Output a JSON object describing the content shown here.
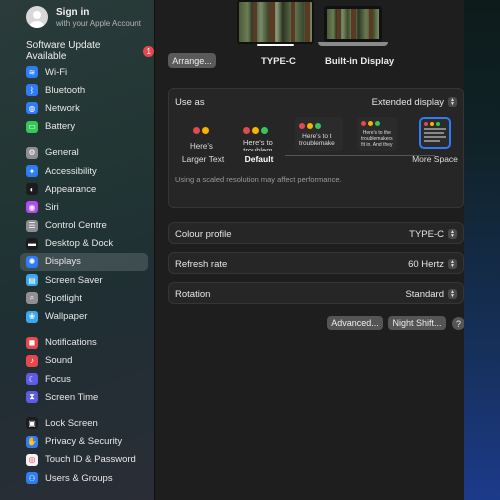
{
  "sidebar": {
    "signin": {
      "title": "Sign in",
      "subtitle": "with your Apple Account"
    },
    "update": {
      "label": "Software Update Available",
      "badge": "1"
    },
    "groups": [
      [
        {
          "label": "Wi-Fi",
          "icon": "wifi-icon",
          "color": "#2f7cf6",
          "glyph": "≋"
        },
        {
          "label": "Bluetooth",
          "icon": "bluetooth-icon",
          "color": "#2f7cf6",
          "glyph": "ᛒ"
        },
        {
          "label": "Network",
          "icon": "globe-icon",
          "color": "#2f7cf6",
          "glyph": "◍"
        },
        {
          "label": "Battery",
          "icon": "battery-icon",
          "color": "#35c759",
          "glyph": "▭"
        }
      ],
      [
        {
          "label": "General",
          "icon": "gear-icon",
          "color": "#8e8e93",
          "glyph": "⚙"
        },
        {
          "label": "Accessibility",
          "icon": "accessibility-icon",
          "color": "#2f7cf6",
          "glyph": "✦"
        },
        {
          "label": "Appearance",
          "icon": "appearance-icon",
          "color": "#1c1c1e",
          "glyph": "◐"
        },
        {
          "label": "Siri",
          "icon": "siri-icon",
          "color": "#b14cf0",
          "glyph": "◉"
        },
        {
          "label": "Control Centre",
          "icon": "control-centre-icon",
          "color": "#8e8e93",
          "glyph": "☰"
        },
        {
          "label": "Desktop & Dock",
          "icon": "dock-icon",
          "color": "#1c1c1e",
          "glyph": "▬"
        },
        {
          "label": "Displays",
          "icon": "display-icon",
          "color": "#2f7cf6",
          "glyph": "✺"
        },
        {
          "label": "Screen Saver",
          "icon": "screen-saver-icon",
          "color": "#3aa7f0",
          "glyph": "▤"
        },
        {
          "label": "Spotlight",
          "icon": "search-icon",
          "color": "#8e8e93",
          "glyph": "⌕"
        },
        {
          "label": "Wallpaper",
          "icon": "wallpaper-icon",
          "color": "#3aa7f0",
          "glyph": "❀"
        }
      ],
      [
        {
          "label": "Notifications",
          "icon": "bell-icon",
          "color": "#e5484d",
          "glyph": "◼"
        },
        {
          "label": "Sound",
          "icon": "speaker-icon",
          "color": "#e5484d",
          "glyph": "♪"
        },
        {
          "label": "Focus",
          "icon": "moon-icon",
          "color": "#5e5ce6",
          "glyph": "☾"
        },
        {
          "label": "Screen Time",
          "icon": "hourglass-icon",
          "color": "#5e5ce6",
          "glyph": "⧗"
        }
      ],
      [
        {
          "label": "Lock Screen",
          "icon": "lock-screen-icon",
          "color": "#1c1c1e",
          "glyph": "▣"
        },
        {
          "label": "Privacy & Security",
          "icon": "hand-icon",
          "color": "#2f7cf6",
          "glyph": "✋"
        },
        {
          "label": "Touch ID & Password",
          "icon": "fingerprint-icon",
          "color": "#f2f2f7",
          "glyph": "◎"
        },
        {
          "label": "Users & Groups",
          "icon": "users-icon",
          "color": "#2f7cf6",
          "glyph": "⚇"
        }
      ]
    ],
    "selected": "Displays"
  },
  "displays": {
    "arrange_label": "Arrange...",
    "external_name": "TYPE-C",
    "builtin_name": "Built-in Display"
  },
  "use_as": {
    "label": "Use as",
    "value": "Extended display",
    "note": "Using a scaled resolution may affect performance.",
    "options": [
      {
        "sample": "Here's",
        "label": "Larger Text"
      },
      {
        "sample": "Here's to",
        "label": "Default"
      },
      {
        "sample": "Here's to t",
        "label": ""
      },
      {
        "sample": "Here's to the",
        "label": ""
      },
      {
        "sample": "",
        "label": "More Space"
      }
    ]
  },
  "settings": [
    {
      "label": "Colour profile",
      "value": "TYPE-C"
    },
    {
      "label": "Refresh rate",
      "value": "60 Hertz"
    },
    {
      "label": "Rotation",
      "value": "Standard"
    }
  ],
  "buttons": {
    "advanced": "Advanced...",
    "night_shift": "Night Shift...",
    "help": "?"
  }
}
